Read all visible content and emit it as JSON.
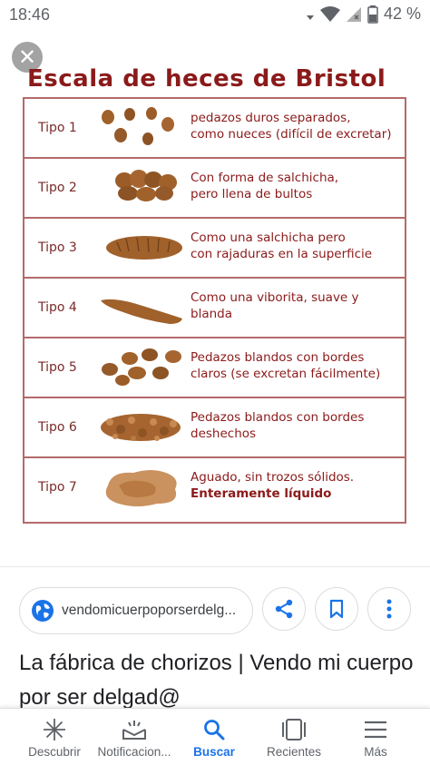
{
  "status_bar": {
    "time": "18:46",
    "battery_percent": "42 %"
  },
  "image": {
    "title": "Escala de heces de Bristol",
    "close_icon": "close-icon",
    "rows": [
      {
        "label": "Tipo 1",
        "lines": [
          "pedazos duros separados,",
          "como nueces (difícil de excretar)"
        ],
        "bold_line": ""
      },
      {
        "label": "Tipo 2",
        "lines": [
          "Con forma de salchicha,",
          "pero llena de bultos"
        ],
        "bold_line": ""
      },
      {
        "label": "Tipo 3",
        "lines": [
          "Como una salchicha pero",
          "con rajaduras en la superficie"
        ],
        "bold_line": ""
      },
      {
        "label": "Tipo 4",
        "lines": [
          "Como una viborita, suave y",
          "blanda"
        ],
        "bold_line": ""
      },
      {
        "label": "Tipo 5",
        "lines": [
          "Pedazos blandos con bordes",
          "claros (se excretan fácilmente)"
        ],
        "bold_line": ""
      },
      {
        "label": "Tipo 6",
        "lines": [
          "Pedazos blandos con bordes",
          "deshechos"
        ],
        "bold_line": ""
      },
      {
        "label": "Tipo 7",
        "lines": [
          "Aguado, sin trozos sólidos."
        ],
        "bold_line": "Enteramente líquido"
      }
    ]
  },
  "source": {
    "domain": "vendomicuerpoporserdelg...",
    "icon": "globe-icon"
  },
  "actions": {
    "share_icon": "share-icon",
    "bookmark_icon": "bookmark-icon",
    "more_icon": "more-vert-icon"
  },
  "page_title": "La fábrica de chorizos | Vendo mi cuerpo por ser delgad@",
  "nav": {
    "items": [
      {
        "label": "Descubrir",
        "icon": "asterisk-icon"
      },
      {
        "label": "Notificacion...",
        "icon": "notifications-icon"
      },
      {
        "label": "Buscar",
        "icon": "search-icon"
      },
      {
        "label": "Recientes",
        "icon": "recent-tabs-icon"
      },
      {
        "label": "Más",
        "icon": "menu-icon"
      }
    ],
    "active_index": 2
  },
  "colors": {
    "title_red": "#8b1a1a",
    "border": "#b46a6a",
    "accent_blue": "#1a73e8",
    "stool_brown": "#a0612b"
  }
}
